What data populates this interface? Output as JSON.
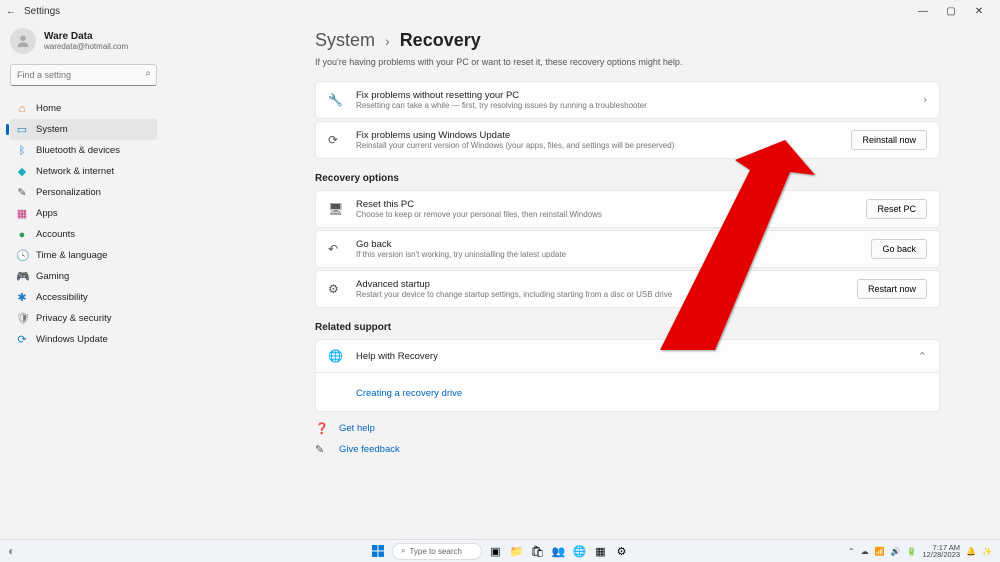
{
  "window": {
    "title": "Settings"
  },
  "user": {
    "name": "Ware Data",
    "email": "waredata@hotmail.com"
  },
  "search": {
    "placeholder": "Find a setting"
  },
  "sidebar": [
    {
      "icon": "⌂",
      "label": "Home",
      "cls": "c-home"
    },
    {
      "icon": "▭",
      "label": "System",
      "cls": "c-sys",
      "active": true
    },
    {
      "icon": "ᛒ",
      "label": "Bluetooth & devices",
      "cls": "c-bt"
    },
    {
      "icon": "◆",
      "label": "Network & internet",
      "cls": "c-net"
    },
    {
      "icon": "✎",
      "label": "Personalization",
      "cls": "c-pers"
    },
    {
      "icon": "▦",
      "label": "Apps",
      "cls": "c-apps"
    },
    {
      "icon": "●",
      "label": "Accounts",
      "cls": "c-acc"
    },
    {
      "icon": "🕓",
      "label": "Time & language",
      "cls": "c-time"
    },
    {
      "icon": "🎮",
      "label": "Gaming",
      "cls": "c-game"
    },
    {
      "icon": "✱",
      "label": "Accessibility",
      "cls": "c-acs"
    },
    {
      "icon": "🛡",
      "label": "Privacy & security",
      "cls": "c-priv"
    },
    {
      "icon": "⟳",
      "label": "Windows Update",
      "cls": "c-wu"
    }
  ],
  "breadcrumb": {
    "parent": "System",
    "current": "Recovery"
  },
  "intro": "If you're having problems with your PC or want to reset it, these recovery options might help.",
  "cards_top": [
    {
      "icon": "🔧",
      "title": "Fix problems without resetting your PC",
      "sub": "Resetting can take a while — first, try resolving issues by running a troubleshooter",
      "chevron": true
    },
    {
      "icon": "⟳",
      "title": "Fix problems using Windows Update",
      "sub": "Reinstall your current version of Windows (your apps, files, and settings will be preserved)",
      "button": "Reinstall now"
    }
  ],
  "sections": {
    "recovery": {
      "title": "Recovery options",
      "items": [
        {
          "icon": "🖥",
          "title": "Reset this PC",
          "sub": "Choose to keep or remove your personal files, then reinstall Windows",
          "button": "Reset PC"
        },
        {
          "icon": "↶",
          "title": "Go back",
          "sub": "If this version isn't working, try uninstalling the latest update",
          "button": "Go back"
        },
        {
          "icon": "⚙",
          "title": "Advanced startup",
          "sub": "Restart your device to change startup settings, including starting from a disc or USB drive",
          "button": "Restart now"
        }
      ]
    },
    "support": {
      "title": "Related support",
      "help": {
        "icon": "🌐",
        "title": "Help with Recovery"
      },
      "sublink": "Creating a recovery drive"
    }
  },
  "footer_links": [
    {
      "icon": "❓",
      "label": "Get help"
    },
    {
      "icon": "✎",
      "label": "Give feedback"
    }
  ],
  "taskbar": {
    "search": "Type to search",
    "time": "7:17 AM",
    "date": "12/28/2023"
  }
}
